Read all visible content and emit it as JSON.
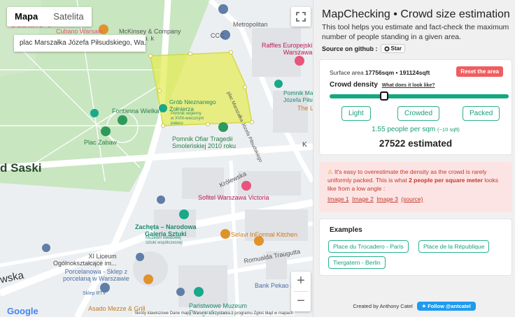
{
  "map": {
    "type_tabs": [
      "Mapa",
      "Satelita"
    ],
    "place_card": "plac Marszałka Józefa Piłsudskiego, Wa...",
    "labels": {
      "metropolitan": "Metropolitan",
      "mckinsey": "McKinsey & Company\np. z oo Sp. k",
      "ccc": "CCC",
      "raffles": "Raffles Europejski\nWarszawa",
      "grob": "Grób Nieznanego\nŻołnierza",
      "grob_sub": "Pomnik wojenny\nw XVIII-wiecznym\npałacu",
      "fontanna": "Fontanna Wielka",
      "plac_zabaw": "Plac Zabaw",
      "pomnik_ofiar": "Pomnik Ofiar Tragedii\nSmoleńskiej 2010 roku",
      "pomnik_marszalka": "Pomnik Marszał\nJózefa Piłsudski",
      "the_l": "The L",
      "saski": "d Saski",
      "krolewska": "Królewska",
      "sofitel": "Sofitel Warszawa Victoria",
      "zacheta": "Zachęta – Narodowa\nGaleria Sztuki",
      "zacheta_sub": "Muzeum światowej\nsztuki współczesnej",
      "selavi": "Selavi",
      "informal": "InFormal Kitchen",
      "xi_liceum": "XI Liceum\nOgólnokształcące im...",
      "porcelanowa": "Porcelanowa - Sklep z\nporcelaną w Warszawie",
      "romualda": "Romualda Traugutta",
      "bank_pekao": "Bank Pekao S.A",
      "skleprtv": "Sklep RTV",
      "asado": "Asado Mezze & Grill",
      "panstwowe": "Państwowe Muzeum\nEtnograficzne w...",
      "wska": "wska",
      "cubano": "Cubano V",
      "cubano2": "Cubano Warsaw",
      "plac_marszalka_street": "plac Marszałka Józefa Piłsudskiego",
      "k": "K"
    },
    "google": "Google",
    "attribution": "Skróty klawiszowe   Dane mapy   Warunki korzystania z programu   Zgłoś błąd w mapach"
  },
  "panel": {
    "title": "MapChecking • Crowd size estimation",
    "description": "This tool helps you estimate and fact-check the maximum number of people standing in a given area.",
    "source_label": "Source on github :",
    "star_label": "Star",
    "surface_prefix": "Surface area",
    "surface_value": "17756sqm • 191124sqft",
    "reset_label": "Reset the area",
    "density_label": "Crowd density",
    "density_link": "What does it look like?",
    "density_fraction": 0.305,
    "presets": [
      "Light",
      "Crowded",
      "Packed"
    ],
    "people_per": "1.55 people per sqm",
    "people_per_small": "(~10 sqft)",
    "estimated": "27522 estimated",
    "warning_text_1": "It's easy to overestimate the density as the crowd is rarely uniformly packed. This is what",
    "warning_bold": "2 people per square meter",
    "warning_text_2": "looks like from a low angle :",
    "warning_links": [
      "Image 1",
      "Image 2",
      "Image 3",
      "(source)"
    ],
    "examples_title": "Examples",
    "examples": [
      "Place du Trocadero - Paris",
      "Place de la République",
      "Tiergatern - Berlin"
    ],
    "footer_text": "Created by Anthony Catel",
    "twitter_label": "Follow @antcatel"
  },
  "colors": {
    "accent": "#14a87f",
    "reset": "#f05d5e",
    "warning_bg": "#fde4e4",
    "polygon": "#e5ec5a"
  }
}
